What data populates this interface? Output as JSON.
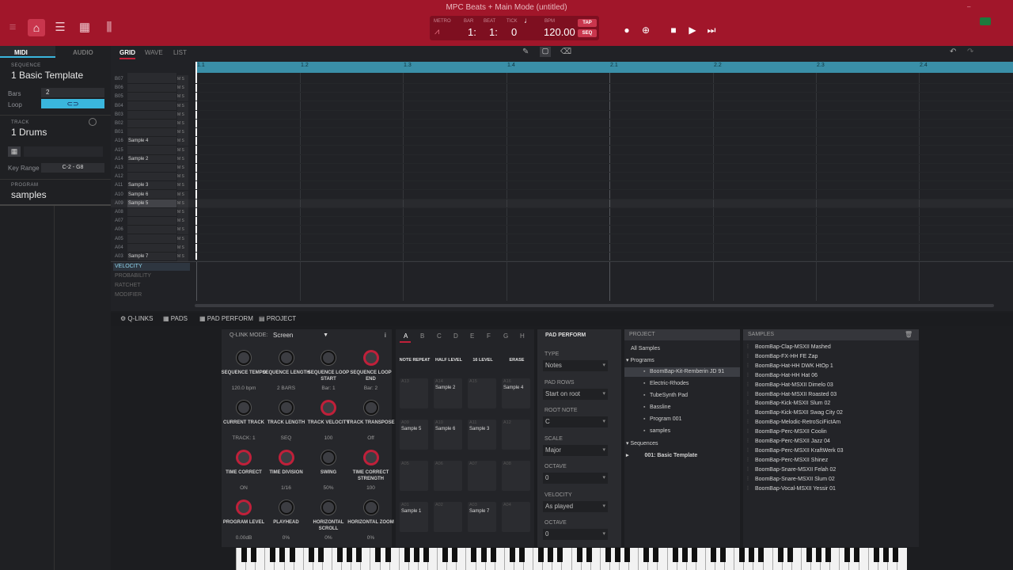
{
  "window": {
    "title": "MPC Beats + Main Mode (untitled)"
  },
  "colors": {
    "accent": "#a1162a",
    "loop_active": "#3ab6dd",
    "ruler": "#3a8fa8"
  },
  "transport": {
    "labels": {
      "metro": "METRO",
      "bar": "BAR",
      "beat": "BEAT",
      "tick": "TICK",
      "bpm": "BPM"
    },
    "bar": "1:",
    "beat": "1:",
    "tick": "0",
    "bpm": "120.00",
    "tap": "TAP",
    "seq": "SEQ"
  },
  "left": {
    "tabs": {
      "midi": "MIDI",
      "audio": "AUDIO"
    },
    "sequence": {
      "caption": "SEQUENCE",
      "name": "1 Basic Template",
      "bars_label": "Bars",
      "bars_value": "2",
      "loop_label": "Loop"
    },
    "track": {
      "caption": "TRACK",
      "name": "1 Drums",
      "keyrange_label": "Key Range",
      "keyrange_value": "C-2 - G8"
    },
    "program": {
      "caption": "PROGRAM",
      "name": "samples"
    }
  },
  "grid": {
    "tabs": {
      "grid": "GRID",
      "wave": "WAVE",
      "list": "LIST"
    },
    "ruler": [
      "1.1",
      "1.2",
      "1.3",
      "1.4",
      "2.1",
      "2.2",
      "2.3",
      "2.4"
    ],
    "rows": [
      {
        "pad": "B07",
        "name": ""
      },
      {
        "pad": "B06",
        "name": ""
      },
      {
        "pad": "B05",
        "name": ""
      },
      {
        "pad": "B04",
        "name": ""
      },
      {
        "pad": "B03",
        "name": ""
      },
      {
        "pad": "B02",
        "name": ""
      },
      {
        "pad": "B01",
        "name": ""
      },
      {
        "pad": "A16",
        "name": "Sample 4"
      },
      {
        "pad": "A15",
        "name": ""
      },
      {
        "pad": "A14",
        "name": "Sample 2"
      },
      {
        "pad": "A13",
        "name": ""
      },
      {
        "pad": "A12",
        "name": ""
      },
      {
        "pad": "A11",
        "name": "Sample 3"
      },
      {
        "pad": "A10",
        "name": "Sample 6"
      },
      {
        "pad": "A09",
        "name": "Sample 5"
      },
      {
        "pad": "A08",
        "name": ""
      },
      {
        "pad": "A07",
        "name": ""
      },
      {
        "pad": "A06",
        "name": ""
      },
      {
        "pad": "A05",
        "name": ""
      },
      {
        "pad": "A04",
        "name": ""
      },
      {
        "pad": "A03",
        "name": "Sample 7"
      }
    ],
    "ms": "M S",
    "lanes": [
      "VELOCITY",
      "PROBABILITY",
      "RATCHET",
      "MODIFIER"
    ]
  },
  "bottom_tabs": {
    "qlinks": "Q-LINKS",
    "pads": "PADS",
    "pad_perform": "PAD PERFORM",
    "project": "PROJECT"
  },
  "qlinks": {
    "mode_label": "Q-LINK MODE:",
    "mode_value": "Screen",
    "info": "i",
    "knobs": [
      {
        "name": "SEQUENCE TEMPO",
        "value": "120.0 bpm",
        "red": false
      },
      {
        "name": "SEQUENCE LENGTH",
        "value": "2 BARS",
        "red": false
      },
      {
        "name": "SEQUENCE LOOP START",
        "value": "Bar: 1",
        "red": false
      },
      {
        "name": "SEQUENCE LOOP END",
        "value": "Bar: 2",
        "red": true
      },
      {
        "name": "CURRENT TRACK",
        "value": "TRACK: 1",
        "red": false
      },
      {
        "name": "TRACK LENGTH",
        "value": "SEQ",
        "red": false
      },
      {
        "name": "TRACK VELOCITY",
        "value": "100",
        "red": true
      },
      {
        "name": "TRACK TRANSPOSE",
        "value": "Off",
        "red": false
      },
      {
        "name": "TIME CORRECT",
        "value": "ON",
        "red": true
      },
      {
        "name": "TIME DIVISION",
        "value": "1/16",
        "red": true
      },
      {
        "name": "SWING",
        "value": "50%",
        "red": false
      },
      {
        "name": "TIME CORRECT STRENGTH",
        "value": "100",
        "red": true
      },
      {
        "name": "PROGRAM LEVEL",
        "value": "0.00dB",
        "red": true
      },
      {
        "name": "PLAYHEAD",
        "value": "0%",
        "red": false
      },
      {
        "name": "HORIZONTAL SCROLL",
        "value": "0%",
        "red": false
      },
      {
        "name": "HORIZONTAL ZOOM",
        "value": "0%",
        "red": false
      }
    ]
  },
  "pads": {
    "banks": [
      "A",
      "B",
      "C",
      "D",
      "E",
      "F",
      "G",
      "H"
    ],
    "buttons": [
      "NOTE REPEAT",
      "HALF LEVEL",
      "16 LEVEL",
      "ERASE"
    ],
    "grid": [
      {
        "num": "A13",
        "name": ""
      },
      {
        "num": "A14",
        "name": "Sample 2"
      },
      {
        "num": "A15",
        "name": ""
      },
      {
        "num": "A16",
        "name": "Sample 4"
      },
      {
        "num": "A09",
        "name": "Sample 5"
      },
      {
        "num": "A10",
        "name": "Sample 6"
      },
      {
        "num": "A11",
        "name": "Sample 3"
      },
      {
        "num": "A12",
        "name": ""
      },
      {
        "num": "A05",
        "name": ""
      },
      {
        "num": "A06",
        "name": ""
      },
      {
        "num": "A07",
        "name": ""
      },
      {
        "num": "A08",
        "name": ""
      },
      {
        "num": "A01",
        "name": "Sample 1"
      },
      {
        "num": "A02",
        "name": ""
      },
      {
        "num": "A03",
        "name": "Sample 7"
      },
      {
        "num": "A04",
        "name": ""
      }
    ]
  },
  "pad_perform": {
    "title": "PAD PERFORM",
    "fields": [
      {
        "label": "TYPE",
        "value": "Notes"
      },
      {
        "label": "PAD ROWS",
        "value": "Start on root"
      },
      {
        "label": "ROOT NOTE",
        "value": "C"
      },
      {
        "label": "SCALE",
        "value": "Major"
      },
      {
        "label": "OCTAVE",
        "value": "0"
      },
      {
        "label": "VELOCITY",
        "value": "As played"
      },
      {
        "label": "OCTAVE",
        "value": "0"
      }
    ]
  },
  "project": {
    "title": "PROJECT",
    "all_samples": "All Samples",
    "programs_label": "Programs",
    "programs": [
      "BoomBap-Kit-Remberin JD 91",
      "Electric-Rhodes",
      "TubeSynth Pad",
      "Bassline",
      "Program 001",
      "samples"
    ],
    "sequences_label": "Sequences",
    "sequences": [
      "001: Basic Template"
    ]
  },
  "samples": {
    "title": "SAMPLES",
    "items": [
      "BoomBap-Clap-MSXII Mashed",
      "BoomBap-FX-HH FE Zap",
      "BoomBap-Hat-HH DWK HtOp 1",
      "BoomBap-Hat-HH Hat 06",
      "BoomBap-Hat-MSXII Dimelo 03",
      "BoomBap-Hat-MSXII Roasted 03",
      "BoomBap-Kick-MSXII Slum 02",
      "BoomBap-Kick-MSXII Swag City 02",
      "BoomBap-Melodic-RetroSciFictAm",
      "BoomBap-Perc-MSXII Coolin",
      "BoomBap-Perc-MSXII Jazz 04",
      "BoomBap-Perc-MSXII KraftWerk 03",
      "BoomBap-Perc-MSXII Shinez",
      "BoomBap-Snare-MSXII Felah 02",
      "BoomBap-Snare-MSXII Slum 02",
      "BoomBap-Vocal-MSXII Yessir 01"
    ]
  }
}
